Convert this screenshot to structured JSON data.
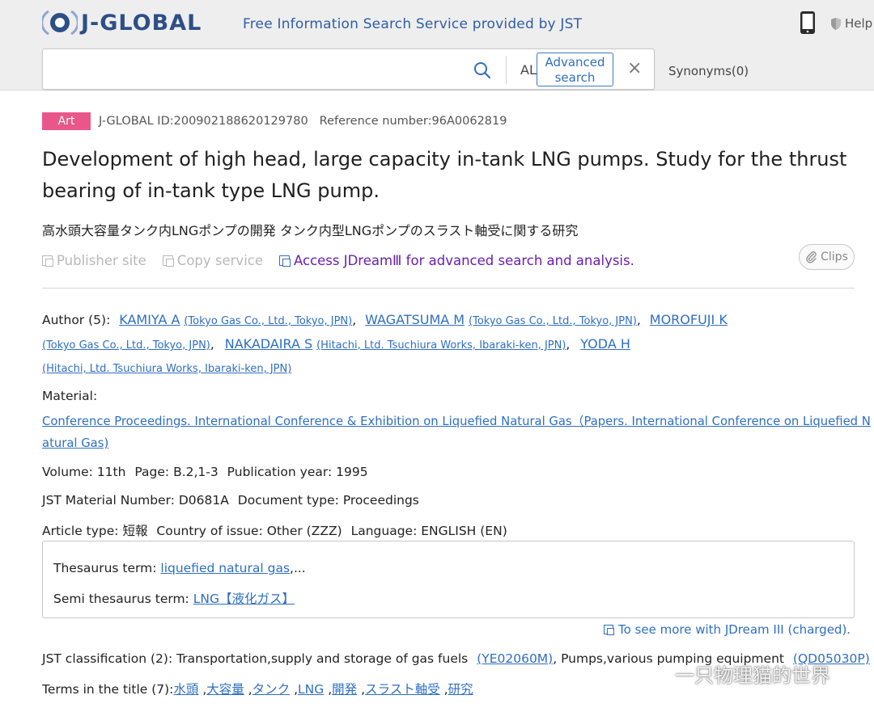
{
  "header": {
    "logo_text": "J-GLOBAL",
    "tagline": "Free Information Search Service provided by JST",
    "help_label": "Help",
    "brand_color": "#2c4f86"
  },
  "search": {
    "value": "",
    "placeholder": "",
    "scope": "ALL",
    "advanced_line1": "Advanced",
    "advanced_line2": "search",
    "clear": "×",
    "synonyms": "Synonyms(0)"
  },
  "meta": {
    "badge": "Art",
    "badge_color": "#e9578a",
    "jglobal_id": "J-GLOBAL ID:200902188620129780",
    "reference": "Reference number:96A0062819"
  },
  "title": "Development of high head, large capacity in-tank LNG pumps. Study for the thrust bearing of in-tank type LNG pump.",
  "title_jp": "高水頭大容量タンク内LNGポンプの開発 タンク内型LNGポンプのスラスト軸受に関する研究",
  "actions": {
    "publisher": "Publisher site",
    "copy": "Copy service",
    "jdream": "Access JDreamⅢ for advanced search and analysis.",
    "clips": "Clips"
  },
  "authors": {
    "label": "Author (5):",
    "list": [
      {
        "name": "KAMIYA A",
        "aff": "(Tokyo Gas Co., Ltd., Tokyo, JPN)"
      },
      {
        "name": "WAGATSUMA M",
        "aff": "(Tokyo Gas Co., Ltd., Tokyo, JPN)"
      },
      {
        "name": "MOROFUJI K",
        "aff": "(Tokyo Gas Co., Ltd., Tokyo, JPN)"
      },
      {
        "name": "NAKADAIRA S",
        "aff": "(Hitachi, Ltd. Tsuchiura Works, Ibaraki-ken, JPN)"
      },
      {
        "name": "YODA H",
        "aff": "(Hitachi, Ltd. Tsuchiura Works, Ibaraki-ken, JPN)"
      }
    ]
  },
  "material": {
    "label": "Material:",
    "line1": "Conference Proceedings. International Conference & Exhibition on Liquefied Natural Gas（Papers. International Conference on Liquefied N",
    "line2": "atural Gas)"
  },
  "volume": {
    "label": "Volume:",
    "value": "11th",
    "page_label": "Page:",
    "page": "B.2,1-3",
    "year_label": "Publication year:",
    "year": "1995"
  },
  "jst_material": {
    "label": "JST Material Number:",
    "value": "D0681A",
    "doctype_label": "Document type:",
    "doctype": "Proceedings"
  },
  "article": {
    "label": "Article type:",
    "value": "短報",
    "country_label": "Country of issue:",
    "country": "Other (ZZZ)",
    "lang_label": "Language:",
    "lang": "ENGLISH (EN)"
  },
  "thesaurus": {
    "label": "Thesaurus term:",
    "value": "liquefied natural gas",
    "ellipsis": ",...",
    "semi_label": "Semi thesaurus term:",
    "semi_value": "LNG【液化ガス】"
  },
  "jdream_more": "To see more with JDream III (charged).",
  "classification": {
    "label": "JST classification (2):",
    "item1": "Transportation,supply and storage of gas fuels",
    "code1": "(YE02060M)",
    "item2": "Pumps,various pumping equipment",
    "code2": "(QD05030P)"
  },
  "terms": {
    "label": "Terms in the title (7):",
    "list": [
      "水頭",
      "大容量",
      "タンク",
      "LNG",
      "開発",
      "スラスト軸受",
      "研究"
    ]
  },
  "watermark": "一只物理猫的世界"
}
